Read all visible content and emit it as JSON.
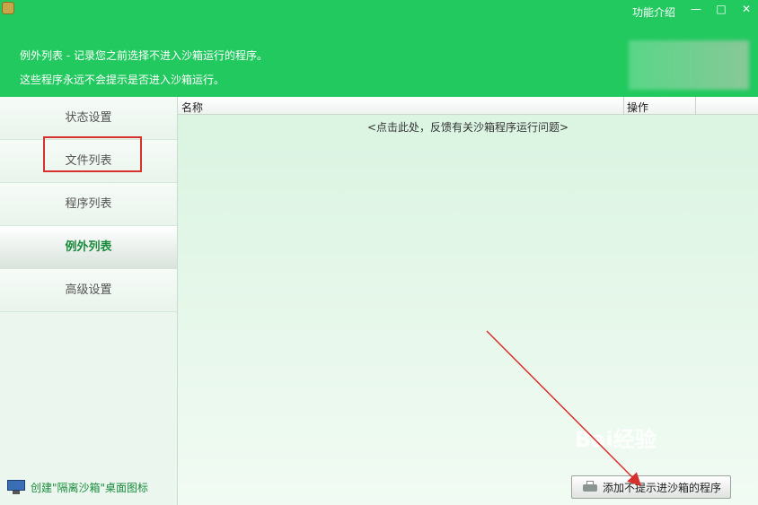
{
  "header": {
    "func_intro": "功能介绍",
    "window_controls": {
      "minimize": "—",
      "maximize": "□",
      "close": "✕"
    },
    "desc_line1": "例外列表 - 记录您之前选择不进入沙箱运行的程序。",
    "desc_line2": "这些程序永远不会提示是否进入沙箱运行。"
  },
  "sidebar": {
    "items": [
      {
        "label": "状态设置"
      },
      {
        "label": "文件列表"
      },
      {
        "label": "程序列表"
      },
      {
        "label": "例外列表",
        "active": true
      },
      {
        "label": "高级设置"
      }
    ],
    "footer_link": "创建\"隔离沙箱\"桌面图标"
  },
  "table": {
    "columns": [
      "名称",
      "操作"
    ],
    "feedback_row": "<点击此处，反馈有关沙箱程序运行问题>"
  },
  "add_button": "添加不提示进沙箱的程序",
  "watermark": "Bai经验",
  "colors": {
    "header_bg": "#22c95f",
    "accent_green": "#1a8a3c",
    "highlight_red": "#d8302c"
  }
}
